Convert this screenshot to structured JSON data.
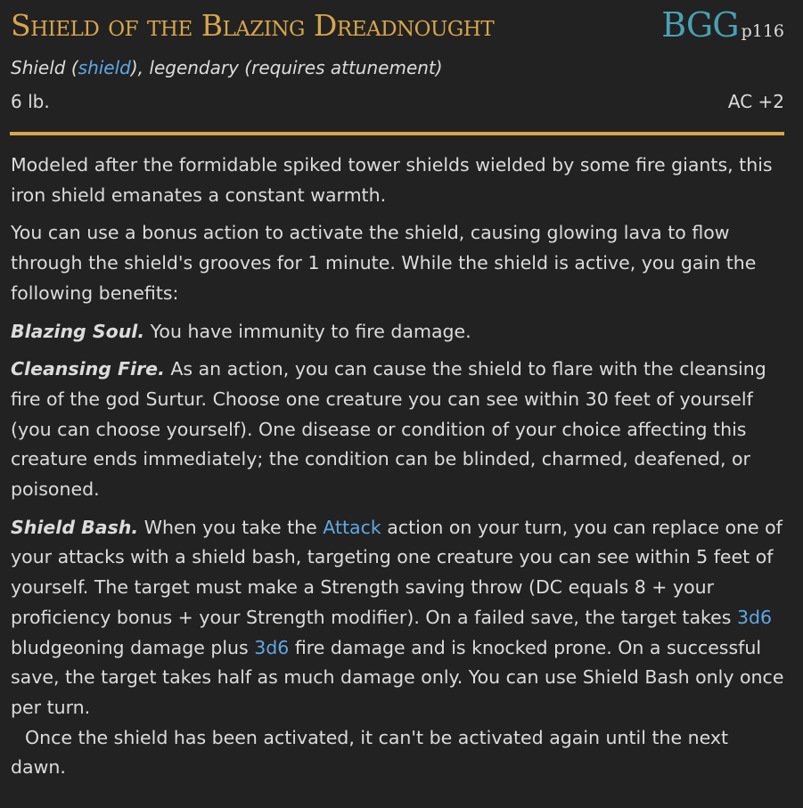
{
  "item": {
    "name": "Shield of the Blazing Dreadnought",
    "source_abbr": "BGG",
    "source_page": "p116",
    "type_prefix": "Shield (",
    "type_link": "shield",
    "type_suffix": "), legendary (requires attunement)",
    "weight": "6 lb.",
    "ac": "AC +2"
  },
  "colors": {
    "title": "#d7a54b",
    "source": "#4aa0b2",
    "link": "#5fa8e6",
    "background": "#222222",
    "text": "#dcdcdc"
  },
  "description": {
    "intro": "Modeled after the formidable spiked tower shields wielded by some fire giants, this iron shield emanates a constant warmth.",
    "activation": "You can use a bonus action to activate the shield, causing glowing lava to flow through the shield's grooves for 1 minute. While the shield is active, you gain the following benefits:",
    "blazing_soul": {
      "name": "Blazing Soul.",
      "text": " You have immunity to fire damage."
    },
    "cleansing_fire": {
      "name": "Cleansing Fire.",
      "text": " As an action, you can cause the shield to flare with the cleansing fire of the god Surtur. Choose one creature you can see within 30 feet of yourself (you can choose yourself). One disease or condition of your choice affecting this creature ends immediately; the condition can be blinded, charmed, deafened, or poisoned."
    },
    "shield_bash": {
      "name": "Shield Bash.",
      "text_a": " When you take the ",
      "link_attack": "Attack",
      "text_b": " action on your turn, you can replace one of your attacks with a shield bash, targeting one creature you can see within 5 feet of yourself. The target must make a Strength saving throw (DC equals 8 + your proficiency bonus + your Strength modifier). On a failed save, the target takes ",
      "dice_1": "3d6",
      "text_c": " bludgeoning damage plus ",
      "dice_2": "3d6",
      "text_d": " fire damage and is knocked prone. On a successful save, the target takes half as much damage only. You can use Shield Bash only once per turn."
    },
    "recharge": "Once the shield has been activated, it can't be activated again until the next dawn."
  }
}
